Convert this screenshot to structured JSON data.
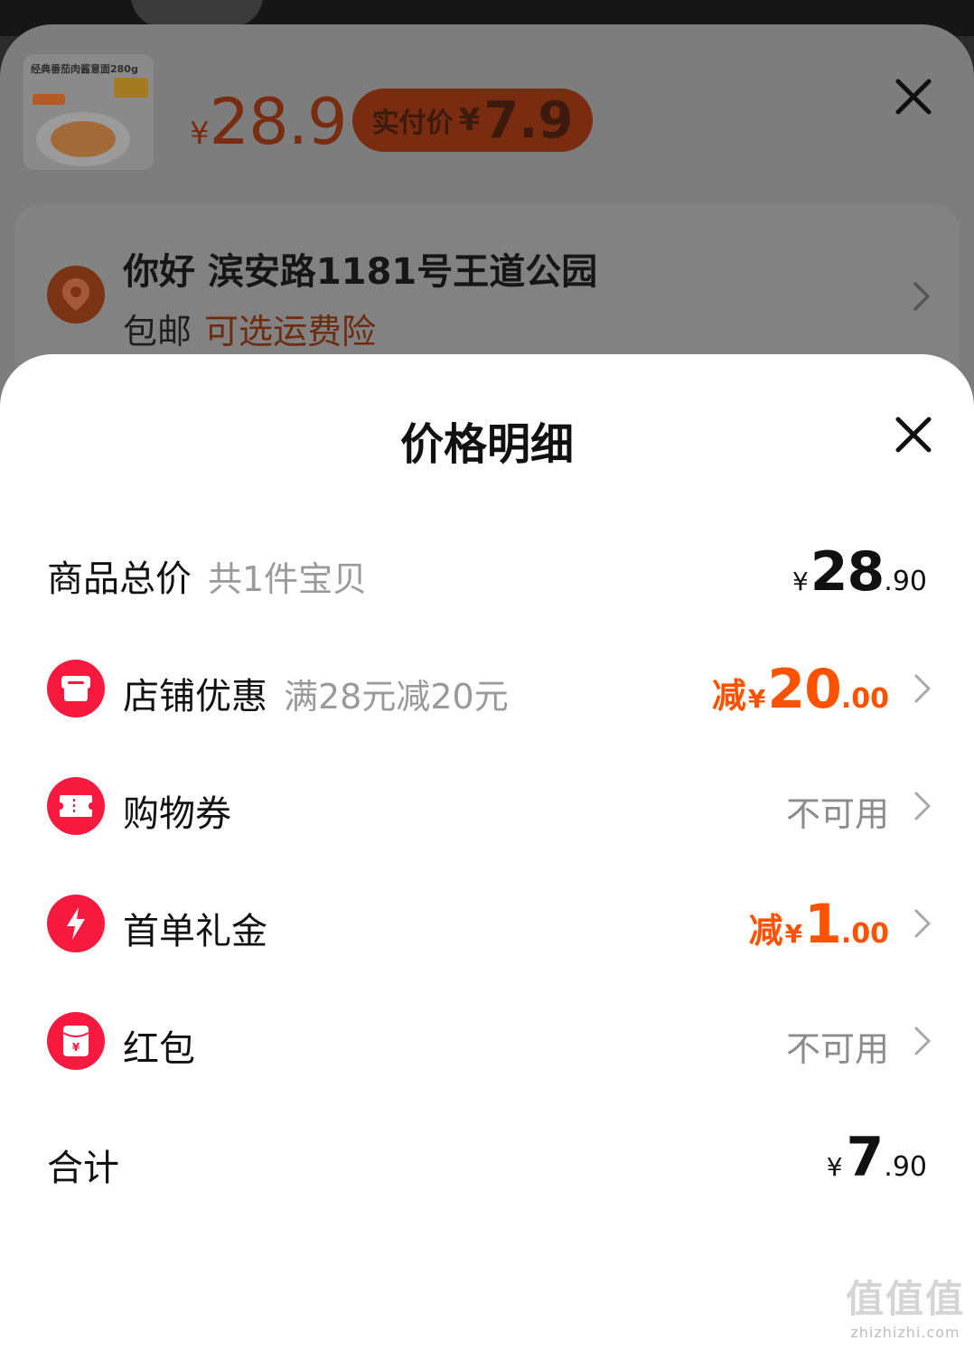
{
  "background": {
    "product": {
      "thumb_label": "经典番茄肉酱意面280g",
      "price_yen": "¥",
      "price": "28.9",
      "pay_label": "实付价",
      "pay_yen": "¥",
      "pay_price": "7.9"
    },
    "address": {
      "line": "你好 滨安路1181号王道公园",
      "shipping": "包邮",
      "insurance": "可选运费险"
    }
  },
  "sheet": {
    "title": "价格明细",
    "rows": [
      {
        "label": "商品总价",
        "note": "共1件宝贝",
        "yen": "¥",
        "int": "28",
        "dec": ".90"
      },
      {
        "label": "店铺优惠",
        "note": "满28元减20元",
        "prefix": "减",
        "yen": "¥",
        "int": "20",
        "dec": ".00"
      },
      {
        "label": "购物券",
        "status": "不可用"
      },
      {
        "label": "首单礼金",
        "prefix": "减",
        "yen": "¥",
        "int": "1",
        "dec": ".00"
      },
      {
        "label": "红包",
        "status": "不可用"
      }
    ],
    "total": {
      "label": "合计",
      "yen": "¥",
      "int": "7",
      "dec": ".90"
    }
  },
  "watermark": {
    "glyphs": "值值值",
    "url": "zhizhizhi.com"
  },
  "colors": {
    "accent": "#ff5200",
    "icon_red": "#f7193e",
    "muted": "#9a9a9a"
  },
  "icons": [
    "location-pin-icon",
    "close-icon",
    "chevron-right-icon",
    "store-icon",
    "ticket-icon",
    "lightning-icon",
    "red-envelope-icon"
  ]
}
